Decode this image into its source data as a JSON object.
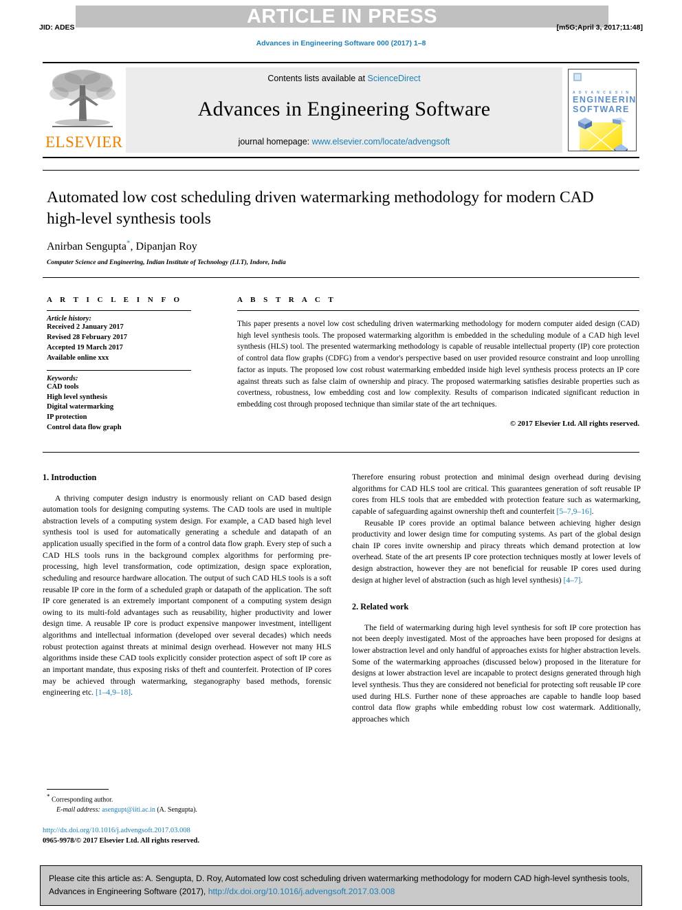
{
  "banner": {
    "article_in_press": "ARTICLE IN PRESS",
    "jid": "JID: ADES",
    "stamp": "[m5G;April 3, 2017;11:48]",
    "running_head": "Advances in Engineering Software 000 (2017) 1–8"
  },
  "masthead": {
    "publisher": "ELSEVIER",
    "contents_prefix": "Contents lists available at ",
    "contents_link": "ScienceDirect",
    "journal_name": "Advances in Engineering Software",
    "homepage_prefix": "journal homepage: ",
    "homepage_url": "www.elsevier.com/locate/advengsoft",
    "cover": {
      "line_small": "A D V A N C E S   I N",
      "line1": "ENGINEERING",
      "line2": "SOFTWARE"
    }
  },
  "article": {
    "title": "Automated low cost scheduling driven watermarking methodology for modern CAD high-level synthesis tools",
    "authors": "Anirban Sengupta, Dipanjan Roy",
    "author_marker": "*",
    "affiliation": "Computer Science and Engineering, Indian Institute of Technology (I.I.T), Indore, India"
  },
  "info": {
    "heading": "A R T I C L E   I N F O",
    "history_label": "Article history:",
    "history": [
      "Received 2 January 2017",
      "Revised 28 February 2017",
      "Accepted 19 March 2017",
      "Available online xxx"
    ],
    "keywords_label": "Keywords:",
    "keywords": [
      "CAD tools",
      "High level synthesis",
      "Digital watermarking",
      "IP protection",
      "Control data flow graph"
    ]
  },
  "abstract": {
    "heading": "A B S T R A C T",
    "text": "This paper presents a novel low cost scheduling driven watermarking methodology for modern computer aided design (CAD) high level synthesis tools. The proposed watermarking algorithm is embedded in the scheduling module of a CAD high level synthesis (HLS) tool. The presented watermarking methodology is capable of reusable intellectual property (IP) core protection of control data flow graphs (CDFG) from a vendor's perspective based on user provided resource constraint and loop unrolling factor as inputs. The proposed low cost robust watermarking embedded inside high level synthesis process protects an IP core against threats such as false claim of ownership and piracy. The proposed watermarking satisfies desirable properties such as covertness, robustness, low embedding cost and low complexity. Results of comparison indicated significant reduction in embedding cost through proposed technique than similar state of the art techniques.",
    "copyright": "© 2017 Elsevier Ltd. All rights reserved."
  },
  "body": {
    "section1_heading": "1. Introduction",
    "section1_p1_a": "A thriving computer design industry is enormously reliant on CAD based design automation tools for designing computing systems. The CAD tools are used in multiple abstraction levels of a computing system design. For example, a CAD based high level synthesis tool is used for automatically generating a schedule and datapath of an application usually specified in the form of a control data flow graph. Every step of such a CAD HLS tools runs in the background complex algorithms for performing pre-processing, high level transformation, code optimization, design space exploration, scheduling and resource hardware allocation. The output of such CAD HLS tools is a soft reusable IP core in the form of a scheduled graph or datapath of the application. The soft IP core generated is an extremely important component of a computing system design owing to its multi-fold advantages such as reusability, higher productivity and lower design time. A reusable IP core is product expensive manpower investment, intelligent algorithms and intellectual information (developed over several decades) which needs robust protection against threats at minimal design overhead. However not many HLS algorithms inside these CAD tools explicitly consider protection aspect of soft IP core as an important mandate, thus exposing risks of theft and counterfeit. Protection of IP cores may be achieved through watermarking, steganography based methods, forensic engineering etc. ",
    "section1_p1_ref": "[1–4,9–18]",
    "section1_p1_b": ".",
    "section1_p2_a": "Therefore ensuring robust protection and minimal design overhead during devising algorithms for CAD HLS tool are critical. This guarantees generation of soft reusable IP cores from HLS tools that are embedded with protection feature such as watermarking, capable of safeguarding against ownership theft and counterfeit ",
    "section1_p2_ref": "[5–7,9–16]",
    "section1_p2_b": ".",
    "section1_p3_a": "Reusable IP cores provide an optimal balance between achieving higher design productivity and lower design time for computing systems. As part of the global design chain IP cores invite ownership and piracy threats which demand protection at low overhead. State of the art presents IP core protection techniques mostly at lower levels of design abstraction, however they are not beneficial for reusable IP cores used during design at higher level of abstraction (such as high level synthesis) ",
    "section1_p3_ref": "[4–7]",
    "section1_p3_b": ".",
    "section2_heading": "2. Related work",
    "section2_p1": "The field of watermarking during high level synthesis for soft IP core protection has not been deeply investigated. Most of the approaches have been proposed for designs at lower abstraction level and only handful of approaches exists for higher abstraction levels. Some of the watermarking approaches (discussed below) proposed in the literature for designs at lower abstraction level are incapable to protect designs generated through high level synthesis. Thus they are considered not beneficial for protecting soft reusable IP core used during HLS. Further none of these approaches are capable to handle loop based control data flow graphs while embedding robust low cost watermark. Additionally, approaches which"
  },
  "footnote": {
    "star": "*",
    "corresponding": " Corresponding author.",
    "email_label": "E-mail address:",
    "email": "asengupt@iiti.ac.in",
    "email_suffix": " (A. Sengupta)."
  },
  "doi_block": {
    "doi": "http://dx.doi.org/10.1016/j.advengsoft.2017.03.008",
    "issn": "0965-9978/© 2017 Elsevier Ltd. All rights reserved."
  },
  "cite_box": {
    "text_a": "Please cite this article as: A. Sengupta, D. Roy, Automated low cost scheduling driven watermarking methodology for modern CAD high-level synthesis tools, Advances in Engineering Software (2017), ",
    "doi": "http://dx.doi.org/10.1016/j.advengsoft.2017.03.008"
  },
  "colors": {
    "link": "#1a7fb5",
    "elsevier_orange": "#f08000",
    "band_gray": "#c0c0c0",
    "cite_gray": "#c8c8c8"
  }
}
